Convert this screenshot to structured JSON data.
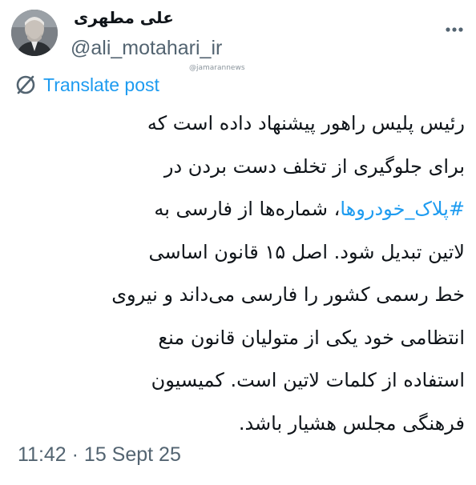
{
  "author": {
    "name": "علی مطهری",
    "handle": "@ali_motahari_ir"
  },
  "watermark": "@jamarannews",
  "translate_label": "Translate post",
  "post": {
    "line1": "رئیس پلیس راهور پیشنهاد داده است که",
    "line2": "برای جلوگیری از تخلف دست بردن در",
    "line3_hashtag": "#پلاک_خودروها",
    "line3_rest": "، شماره‌ها از فارسی به",
    "line4": "لاتین تبدیل شود. اصل ۱۵ قانون اساسی",
    "line5": "خط رسمی کشور را فارسی می‌داند و نیروی",
    "line6": "انتظامی خود یکی از متولیان قانون منع",
    "line7": "استفاده از کلمات لاتین است. کمیسیون",
    "line8": "فرهنگی مجلس هشیار باشد."
  },
  "timestamp": "11:42 · 15 Sept 25",
  "icons": {
    "more": "more-options-icon",
    "translate": "translate-icon"
  },
  "colors": {
    "link": "#1d9bf0",
    "secondary": "#536471",
    "text": "#0f1419"
  }
}
